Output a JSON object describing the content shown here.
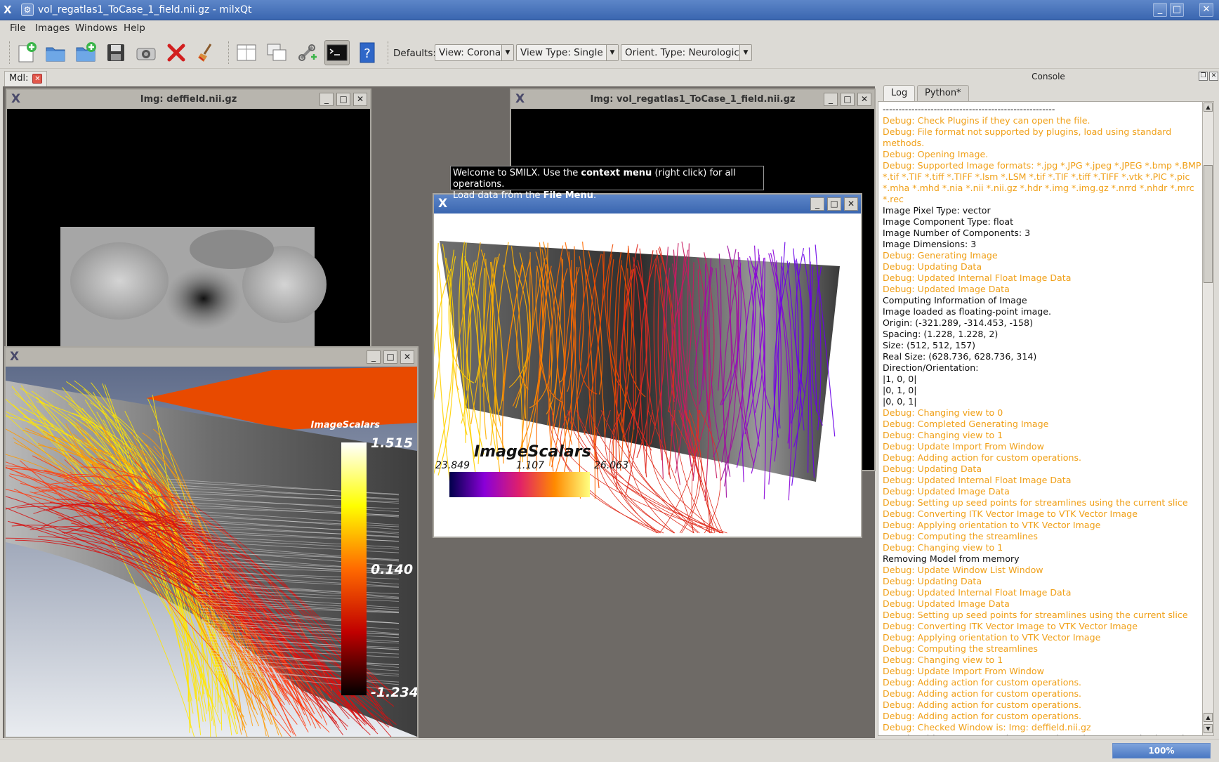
{
  "window": {
    "title": "vol_regatlas1_ToCase_1_field.nii.gz - milxQt",
    "app_icon": "milx-x-icon",
    "minimize": "_",
    "maximize": "□",
    "close": "✕"
  },
  "menu": [
    "File",
    "Images",
    "Windows",
    "Help"
  ],
  "toolbar": {
    "defaults_label": "Defaults:",
    "view": "View: Coronal",
    "view_type": "View Type: Single",
    "orient_type": "Orient. Type: Neurological"
  },
  "mdi": {
    "tab_label": "Mdl:"
  },
  "windows": {
    "deffield": {
      "title": "Img: deffield.nii.gz"
    },
    "vol": {
      "title": "Img: vol_regatlas1_ToCase_1_field.nii.gz"
    }
  },
  "tooltip": {
    "pre": "Welcome to SMILX. Use the ",
    "bold1": "context menu",
    "mid": " (right click) for all operations.",
    "line2_pre": "Load data from the ",
    "bold2": "File Menu",
    "line2_post": "."
  },
  "streamline_view_left": {
    "legend_title": "ImageScalars",
    "max": "1.515",
    "mid": "0.140",
    "min": "-1.234"
  },
  "streamline_view_center": {
    "legend_title": "ImageScalars",
    "left": "23.849",
    "mid": "1.107",
    "right": "26.063"
  },
  "console": {
    "title": "Console",
    "tabs": [
      "Log",
      "Python*"
    ],
    "lines": [
      {
        "t": "info",
        "s": "------------------------------------------------------"
      },
      {
        "t": "debug",
        "s": "Debug: Check Plugins if they can open the file."
      },
      {
        "t": "debug",
        "s": "Debug: File format not supported by plugins, load using standard methods."
      },
      {
        "t": "debug",
        "s": "Debug: Opening Image."
      },
      {
        "t": "debug",
        "s": "Debug: Supported Image formats: *.jpg *.JPG *.jpeg *.JPEG *.bmp *.BMP *.tif *.TIF *.tiff *.TIFF *.lsm *.LSM *.tif *.TIF *.tiff *.TIFF *.vtk *.PIC *.pic *.mha *.mhd *.nia *.nii *.nii.gz *.hdr *.img *.img.gz *.nrrd *.nhdr *.mrc *.rec"
      },
      {
        "t": "info",
        "s": "Image Pixel Type: vector"
      },
      {
        "t": "info",
        "s": "Image Component Type: float"
      },
      {
        "t": "info",
        "s": "Image Number of Components: 3"
      },
      {
        "t": "info",
        "s": "Image Dimensions: 3"
      },
      {
        "t": "debug",
        "s": "Debug: Generating Image"
      },
      {
        "t": "debug",
        "s": "Debug: Updating Data"
      },
      {
        "t": "debug",
        "s": "Debug: Updated Internal Float Image Data"
      },
      {
        "t": "debug",
        "s": "Debug: Updated Image Data"
      },
      {
        "t": "info",
        "s": "Computing Information of Image"
      },
      {
        "t": "info",
        "s": "Image loaded as floating-point image."
      },
      {
        "t": "info",
        "s": "Origin: (-321.289, -314.453, -158)"
      },
      {
        "t": "info",
        "s": "Spacing: (1.228, 1.228, 2)"
      },
      {
        "t": "info",
        "s": "Size: (512, 512, 157)"
      },
      {
        "t": "info",
        "s": "Real Size: (628.736, 628.736, 314)"
      },
      {
        "t": "info",
        "s": "Direction/Orientation:"
      },
      {
        "t": "info",
        "s": "|1, 0, 0|"
      },
      {
        "t": "info",
        "s": "|0, 1, 0|"
      },
      {
        "t": "info",
        "s": "|0, 0, 1|"
      },
      {
        "t": "debug",
        "s": "Debug: Changing view to 0"
      },
      {
        "t": "debug",
        "s": "Debug: Completed Generating Image"
      },
      {
        "t": "debug",
        "s": "Debug: Changing view to 1"
      },
      {
        "t": "debug",
        "s": "Debug: Update Import From Window"
      },
      {
        "t": "debug",
        "s": "Debug: Adding action for custom operations."
      },
      {
        "t": "debug",
        "s": "Debug: Updating Data"
      },
      {
        "t": "debug",
        "s": "Debug: Updated Internal Float Image Data"
      },
      {
        "t": "debug",
        "s": "Debug: Updated Image Data"
      },
      {
        "t": "debug",
        "s": "Debug: Setting up seed points for streamlines using the current slice"
      },
      {
        "t": "debug",
        "s": "Debug: Converting ITK Vector Image to VTK Vector Image"
      },
      {
        "t": "debug",
        "s": "Debug: Applying orientation to VTK Vector Image"
      },
      {
        "t": "debug",
        "s": "Debug: Computing the streamlines"
      },
      {
        "t": "debug",
        "s": "Debug: Changing view to 1"
      },
      {
        "t": "info",
        "s": "Removing Model from memory"
      },
      {
        "t": "debug",
        "s": "Debug: Update Window List Window"
      },
      {
        "t": "debug",
        "s": "Debug: Updating Data"
      },
      {
        "t": "debug",
        "s": "Debug: Updated Internal Float Image Data"
      },
      {
        "t": "debug",
        "s": "Debug: Updated Image Data"
      },
      {
        "t": "debug",
        "s": "Debug: Setting up seed points for streamlines using the current slice"
      },
      {
        "t": "debug",
        "s": "Debug: Converting ITK Vector Image to VTK Vector Image"
      },
      {
        "t": "debug",
        "s": "Debug: Applying orientation to VTK Vector Image"
      },
      {
        "t": "debug",
        "s": "Debug: Computing the streamlines"
      },
      {
        "t": "debug",
        "s": "Debug: Changing view to 1"
      },
      {
        "t": "debug",
        "s": "Debug: Update Import From Window"
      },
      {
        "t": "debug",
        "s": "Debug: Adding action for custom operations."
      },
      {
        "t": "debug",
        "s": "Debug: Adding action for custom operations."
      },
      {
        "t": "debug",
        "s": "Debug: Adding action for custom operations."
      },
      {
        "t": "debug",
        "s": "Debug: Adding action for custom operations."
      },
      {
        "t": "debug",
        "s": "Debug: Checked Window is: Img: deffield.nii.gz"
      },
      {
        "t": "info",
        "s": "Found multi-component scalars. Not using colour map and using colours directly."
      }
    ]
  },
  "status": {
    "progress_text": "100%",
    "progress_fraction": 1.0
  },
  "colors": {
    "titlebar": "#3a66b0",
    "debug_text": "#f0a018",
    "mdi_background": "#6e6a66"
  }
}
